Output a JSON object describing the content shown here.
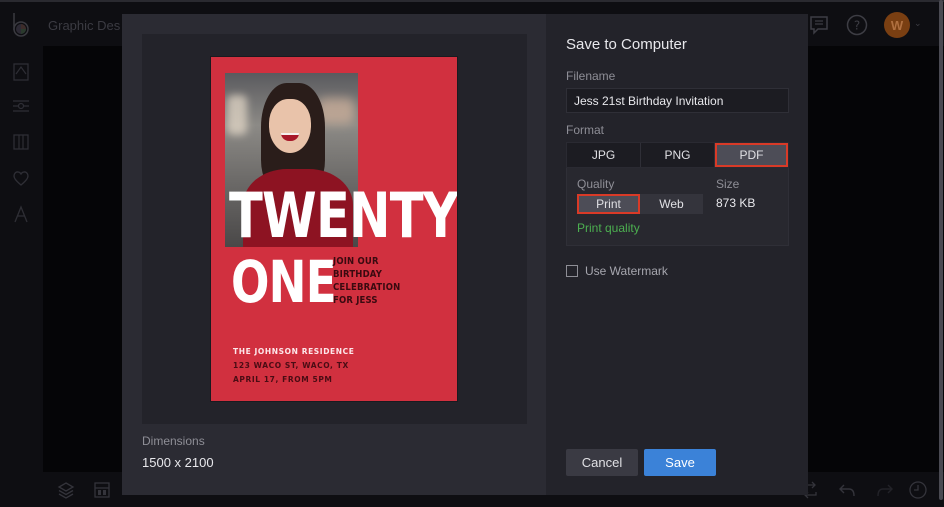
{
  "app": {
    "title": "Graphic Des",
    "avatar_initial": "W",
    "avatar_color": "#7a3f12"
  },
  "top_icons": [
    "chat-icon",
    "help-icon"
  ],
  "sidebar_icons": [
    "template-icon",
    "adjust-icon",
    "columns-icon",
    "favorite-icon",
    "text-icon"
  ],
  "bottom_icons": [
    "layers-icon",
    "layout-icon",
    "replace-icon",
    "undo-icon",
    "redo-icon",
    "history-icon"
  ],
  "preview": {
    "poster": {
      "headline_1": "TWENTY",
      "headline_2": "ONE",
      "invite_lines": [
        "JOIN OUR",
        "BIRTHDAY",
        "CELEBRATION",
        "FOR JESS"
      ],
      "venue": "THE JOHNSON RESIDENCE",
      "address": "123 WACO ST, WACO, TX",
      "date": "APRIL 17, FROM 5PM",
      "background_color": "#d1303f"
    },
    "dimensions_label": "Dimensions",
    "dimensions_value": "1500 x 2100"
  },
  "dialog": {
    "title": "Save to Computer",
    "filename_label": "Filename",
    "filename_value": "Jess 21st Birthday Invitation",
    "format_label": "Format",
    "formats": [
      "JPG",
      "PNG",
      "PDF"
    ],
    "selected_format": "PDF",
    "quality_label": "Quality",
    "qualities": [
      "Print",
      "Web"
    ],
    "selected_quality": "Print",
    "quality_note": "Print quality",
    "size_label": "Size",
    "size_value": "873 KB",
    "watermark_label": "Use Watermark",
    "watermark_checked": false,
    "cancel_label": "Cancel",
    "save_label": "Save",
    "accent_color": "#3b82d8",
    "highlight_color": "#d93a27"
  }
}
